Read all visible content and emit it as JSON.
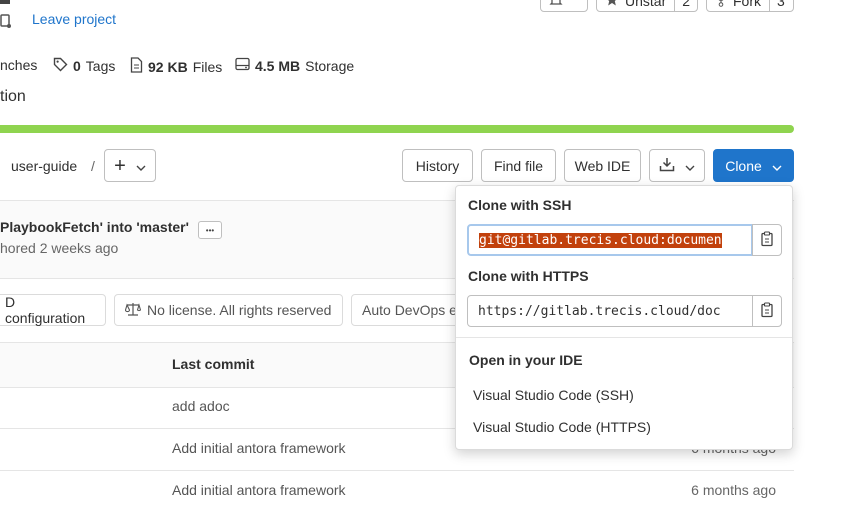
{
  "project": {
    "leave_link": "Leave project",
    "stats": {
      "branches": "nches",
      "tags_count": "0",
      "tags_label": "Tags",
      "files_size": "92 KB",
      "files_label": "Files",
      "storage_size": "4.5 MB",
      "storage_label": "Storage"
    },
    "description": "tion",
    "actions": {
      "unstar_label": "Unstar",
      "unstar_count": "2",
      "fork_label": "Fork",
      "fork_count": "3"
    },
    "progress_color": "#8fd44f"
  },
  "toolbar": {
    "path_segment": "user-guide",
    "separator": "/",
    "add_label": "+",
    "history_label": "History",
    "find_file_label": "Find file",
    "web_ide_label": "Web IDE",
    "clone_label": "Clone"
  },
  "last_commit": {
    "title": "PlaybookFetch' into 'master'",
    "meta": "hored 2 weeks ago",
    "more_label": "•••"
  },
  "badges": {
    "ci_config": "D configuration",
    "license": "No license. All rights reserved",
    "auto_devops": "Auto DevOps e"
  },
  "table": {
    "header_last_commit": "Last commit",
    "rows": [
      {
        "message": "add adoc",
        "age": ""
      },
      {
        "message": "Add initial antora framework",
        "age": "6 months ago"
      },
      {
        "message": "Add initial antora framework",
        "age": "6 months ago"
      }
    ]
  },
  "clone_dropdown": {
    "ssh_heading": "Clone with SSH",
    "ssh_url": "git@gitlab.trecis.cloud:documen",
    "https_heading": "Clone with HTTPS",
    "https_url": "https://gitlab.trecis.cloud/doc",
    "ide_heading": "Open in your IDE",
    "ide_vscode_ssh": "Visual Studio Code (SSH)",
    "ide_vscode_https": "Visual Studio Code (HTTPS)"
  },
  "colors": {
    "primary": "#1f75cb",
    "selection": "#c2410c",
    "progress": "#8fd44f"
  }
}
